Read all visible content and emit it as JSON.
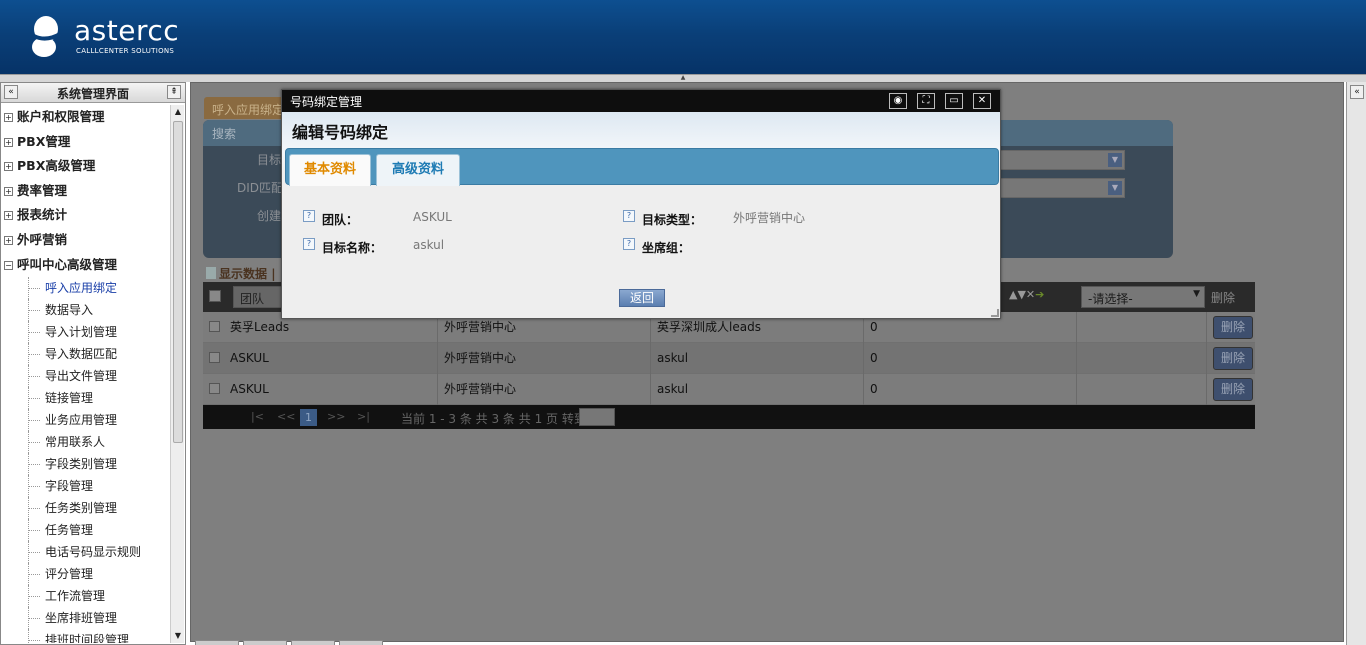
{
  "header": {
    "brand": "astercc",
    "tagline": "CALLLCENTER SOLUTIONS"
  },
  "sidebar": {
    "title": "系统管理界面",
    "collapse_glyph": "«",
    "pin_glyph": "⇞",
    "nodes": [
      {
        "label": "账户和权限管理",
        "expanded": false
      },
      {
        "label": "PBX管理",
        "expanded": false
      },
      {
        "label": "PBX高级管理",
        "expanded": false
      },
      {
        "label": "费率管理",
        "expanded": false
      },
      {
        "label": "报表统计",
        "expanded": false
      },
      {
        "label": "外呼营销",
        "expanded": false
      },
      {
        "label": "呼叫中心高级管理",
        "expanded": true
      }
    ],
    "leaves": [
      "呼入应用绑定",
      "数据导入",
      "导入计划管理",
      "导入数据匹配",
      "导出文件管理",
      "链接管理",
      "业务应用管理",
      "常用联系人",
      "字段类别管理",
      "字段管理",
      "任务类别管理",
      "任务管理",
      "电话号码显示规则",
      "评分管理",
      "工作流管理",
      "坐席排班管理",
      "排班时间段管理"
    ],
    "active_leaf": "呼入应用绑定"
  },
  "background": {
    "tab_label": "呼入应用绑定",
    "search_title": "搜索",
    "field_labels": [
      "目标",
      "DID匹配",
      "创建"
    ],
    "show_data": "显示数据",
    "grid": {
      "filter_column": "团队",
      "select_placeholder": "-请选择-",
      "delete_header": "删除",
      "rows": [
        {
          "team": "英孚Leads",
          "type": "外呼营销中心",
          "target": "英孚深圳成人leads",
          "num": "0",
          "action": "删除"
        },
        {
          "team": "ASKUL",
          "type": "外呼营销中心",
          "target": "askul",
          "num": "0",
          "action": "删除"
        },
        {
          "team": "ASKUL",
          "type": "外呼营销中心",
          "target": "askul",
          "num": "0",
          "action": "删除"
        }
      ],
      "pager": {
        "first": "|<",
        "prev": "<<",
        "current_page": "1",
        "next": ">>",
        "last": ">|",
        "info": "当前 1 - 3 条 共 3 条 共 1 页 转到"
      }
    }
  },
  "dialog": {
    "window_title": "号码绑定管理",
    "heading": "编辑号码绑定",
    "tabs": [
      {
        "label": "基本资料",
        "active": true
      },
      {
        "label": "高级资料",
        "active": false
      }
    ],
    "fields": {
      "team_label": "团队：",
      "team_value": "ASKUL",
      "target_name_label": "目标名称：",
      "target_name_value": "askul",
      "target_type_label": "目标类型：",
      "target_type_value": "外呼营销中心",
      "agent_group_label": "坐席组：",
      "agent_group_value": ""
    },
    "back_button": "返回"
  },
  "colors": {
    "header_blue": "#0a3f78",
    "dialog_tabbar": "#4f95bd",
    "active_tab_text": "#e08a00",
    "inactive_tab_text": "#1e7bb4",
    "overlay_grey": "#7f7f7f"
  }
}
